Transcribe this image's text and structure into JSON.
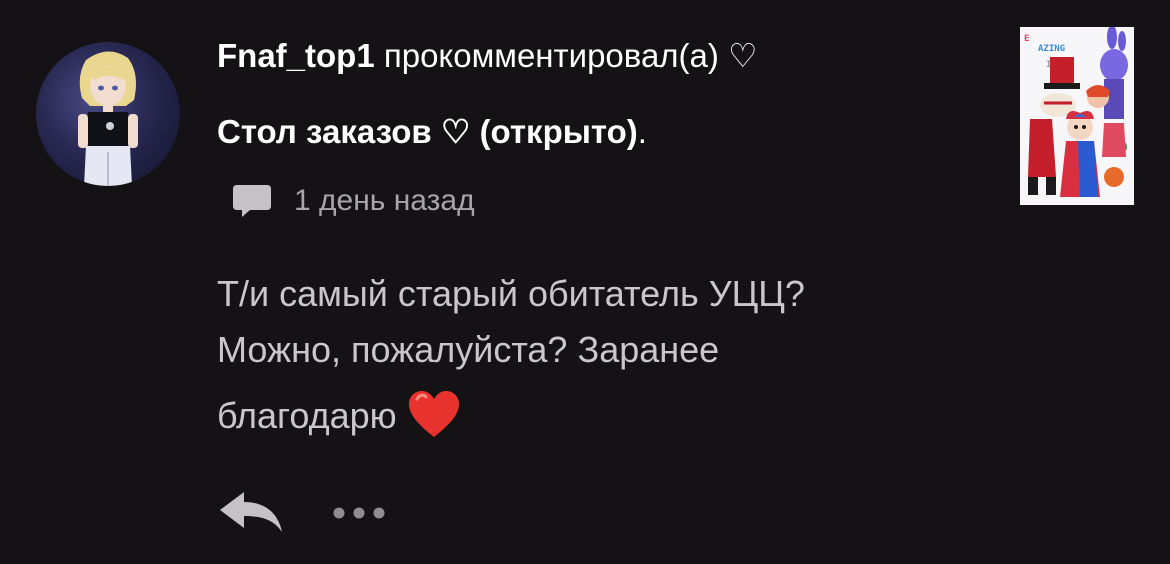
{
  "comment": {
    "username": "Fnaf_top1",
    "action_text": " прокомментировал(а) ♡",
    "post_title": "Стол заказов ♡  (открыто)",
    "post_title_suffix": ".",
    "timestamp": "1 день назад",
    "text_lines": [
      "Т/и самый старый обитатель УЦЦ?",
      "Можно, пожалуйста? Заранее",
      "благодарю"
    ],
    "emoji": "red-heart"
  },
  "icons": {
    "avatar": "user-avatar",
    "comment": "comment-bubble-icon",
    "reply": "reply-arrow-icon",
    "more": "more-dots-icon",
    "thumbnail": "post-thumbnail"
  },
  "thumbnail_caption": {
    "line1": "E",
    "line2": "AZING",
    "line3": "ITAL"
  },
  "colors": {
    "background": "#141214",
    "primary_text": "#ffffff",
    "secondary_text": "#a7a5a9",
    "body_text": "#c9c7cb",
    "icon_gray": "#c4c2c6",
    "heart": "#e8322e"
  }
}
